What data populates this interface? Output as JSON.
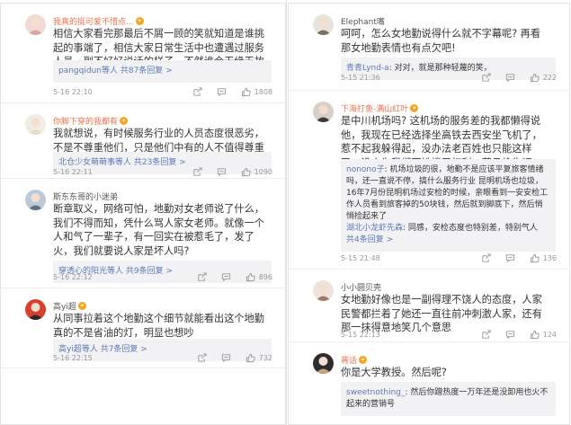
{
  "left": [
    {
      "name": "我真的挺可爱不惜点...",
      "vip": true,
      "text": "相信大家看完那最后不屑一顾的笑就知道是谁挑起的事端了，相信大家日常生活中也遭遇过服务人员一副不好好说话的样子。不然谁会无缘无故的生气",
      "reply": "pangqidun等人  共87条回复 >",
      "time": "5-16 22:10",
      "likes": "1808"
    },
    {
      "name": "你脚下穿的我都有",
      "vip": true,
      "text": "我就想说，有时候服务行业的人员态度很恶劣，不是不尊重他们，只是他们中有的人不值得尊重",
      "reply": "北仓少女萌萌事等人  共23条回复 >",
      "time": "5-16 22:11",
      "likes": "1090"
    },
    {
      "name": "斯东东哥的小迷弟",
      "vip": false,
      "text": "断章取义，网络可怕，地勤对女老师说了什么，我们不得而知，凭什么骂人家女老师。就像一个人和气了一辈子，有一回实在被惹毛了，发了火，我们就要说人家是坏人吗?",
      "reply": "穿透心的阳光等人  共9条回复 >",
      "time": "5-16 22:12",
      "likes": "896"
    },
    {
      "name": "高yi超",
      "vip": true,
      "text": "从同事拉着这个地勤这个细节就能看出这个地勤真的不是省油的灯，明显也想吵",
      "reply": "高yi超等人  共7条回复 >",
      "time": "5-16 22:15",
      "likes": "732"
    }
  ],
  "right": [
    {
      "name": "Elephant嘴",
      "vip": false,
      "text": "呵呵，怎么女地勤说得什么就不字幕呢? 再看那女地勤表情也有点欠吧!",
      "reply_user": "青青Lynd-a",
      "reply_text": ": 对对，就是那种轻蔑的笑，",
      "time": "5-15 21:36",
      "likes": "222"
    },
    {
      "name": "下海打鱼-满山红叶",
      "vip": true,
      "text": "是中川机场吗? 这机场的服务差的我都懒得说他，我现在已经选择坐高铁去西安坐飞机了，惹不起我躲得起，没办法老百姓也只能这样了，没人为我们百姓撑卫权利，苟且偷生吧",
      "reply_user": "nonono子",
      "reply_text": ": 机场垃圾的很，地勤不是应该平复旅客情绪吗，还一直说不停，搞什么服务行业 昆明机场也垃圾，16年7月份昆明机场过安检的时候，亲眼看到一安安检工作人员看到旅客掉的50块钱，然后就到脚底下，然后悄悄捡起来了",
      "reply_user2": "湖北小龙虾先森",
      "reply_text2": ": 同感，安检态度也特别差，特别气人",
      "reply_more": "共4条回复 >",
      "time": "5-15 21:48",
      "likes": "136"
    },
    {
      "name": "小小圆贝壳",
      "vip": false,
      "text": "女地勤好像也是一副得理不饶人的态度，人家民警都拦着了她还一直往前冲刺激人家，还有那一抹得意地笑几个意思",
      "time": "5-15 22:13",
      "likes": "124"
    },
    {
      "name": "蒋话",
      "vip": true,
      "text": "你是大学教授。然后呢?",
      "reply_user": "sweetnothing_",
      "reply_text": ": 然后你蹭热度一万年还是没卸用也火不起来的营销号"
    }
  ],
  "colors": {
    "name": "#eb7350",
    "link": "#eb7350",
    "blue": "#5b7ab5",
    "meta": "#999999"
  },
  "icons": [
    "share-icon",
    "comment-icon",
    "like-icon",
    "vip-badge-icon"
  ]
}
